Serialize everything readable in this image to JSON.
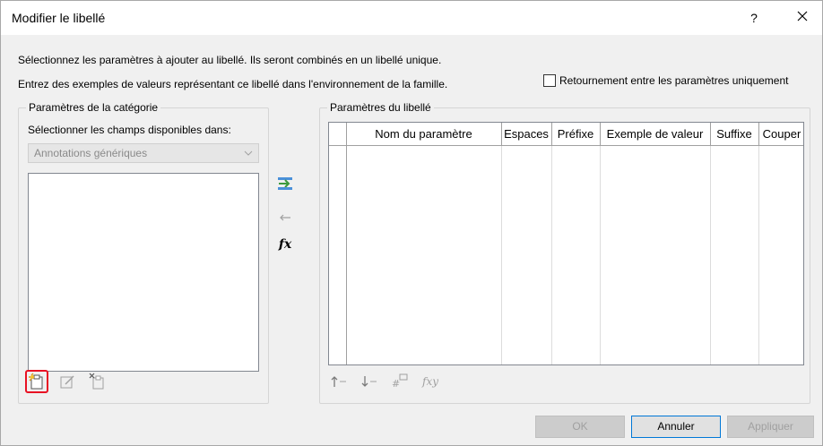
{
  "window": {
    "title": "Modifier le libellé",
    "help_label": "?",
    "close_label": "✕"
  },
  "instructions": {
    "line1": "Sélectionnez les paramètres à ajouter au libellé. Ils seront combinés en un libellé unique.",
    "line2": "Entrez des exemples de valeurs représentant ce libellé dans l'environnement de la famille."
  },
  "flip_checkbox": {
    "label": "Retournement entre les paramètres uniquement",
    "checked": false
  },
  "category_params": {
    "legend": "Paramètres de la catégorie",
    "select_label": "Sélectionner les champs disponibles dans:",
    "select_value": "Annotations génériques",
    "items": [],
    "tools": [
      "new-parameter-icon",
      "edit-parameter-icon",
      "delete-parameter-icon"
    ]
  },
  "middle_actions": [
    "add-parameter-icon",
    "remove-parameter-icon",
    "formula-icon"
  ],
  "label_params": {
    "legend": "Paramètres du libellé",
    "columns": [
      "Nom du paramètre",
      "Espaces",
      "Préfixe",
      "Exemple de valeur",
      "Suffixe",
      "Couper"
    ],
    "rows": [],
    "tools": [
      "move-up-icon",
      "move-down-icon",
      "edit-units-icon",
      "edit-formula-icon"
    ]
  },
  "buttons": {
    "ok": "OK",
    "cancel": "Annuler",
    "apply": "Appliquer"
  },
  "colors": {
    "highlight": "#e81123",
    "accent": "#0078d7"
  }
}
